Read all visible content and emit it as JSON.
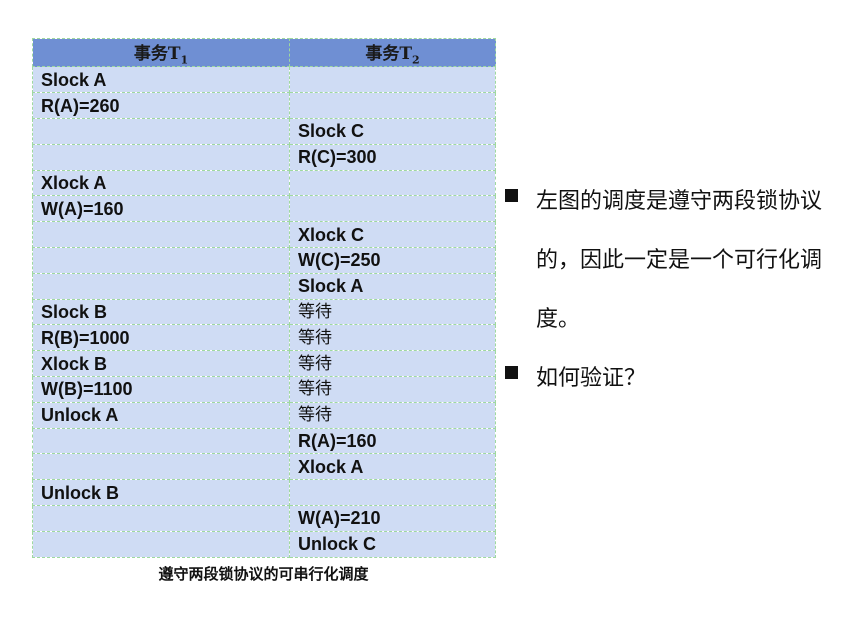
{
  "table": {
    "headers": {
      "t1": {
        "label": "事务T",
        "sub": "1"
      },
      "t2": {
        "label": "事务T",
        "sub": "2"
      }
    },
    "rows": [
      {
        "t1": "Slock  A",
        "t2": ""
      },
      {
        "t1": "R(A)=260",
        "t2": ""
      },
      {
        "t1": "",
        "t2": "Slock  C"
      },
      {
        "t1": "",
        "t2": "R(C)=300"
      },
      {
        "t1": "Xlock A",
        "t2": ""
      },
      {
        "t1": "W(A)=160",
        "t2": ""
      },
      {
        "t1": "",
        "t2": "Xlock  C"
      },
      {
        "t1": "",
        "t2": "W(C)=250"
      },
      {
        "t1": "",
        "t2": "Slock  A"
      },
      {
        "t1": "Slock  B",
        "t2": "等待"
      },
      {
        "t1": "R(B)=1000",
        "t2": "等待"
      },
      {
        "t1": "Xlock B",
        "t2": "等待"
      },
      {
        "t1": "W(B)=1100",
        "t2": " 等待"
      },
      {
        "t1": "Unlock  A",
        "t2": "等待"
      },
      {
        "t1": "",
        "t2": "R(A)=160"
      },
      {
        "t1": "",
        "t2": "Xlock  A"
      },
      {
        "t1": "Unlock  B",
        "t2": ""
      },
      {
        "t1": "",
        "t2": "W(A)=210"
      },
      {
        "t1": "",
        "t2": "Unlock  C"
      }
    ],
    "caption": "遵守两段锁协议的可串行化调度"
  },
  "notes": {
    "bullets": [
      "左图的调度是遵守两段锁协议的，因此一定是一个可行化调度。",
      "如何验证？"
    ]
  }
}
